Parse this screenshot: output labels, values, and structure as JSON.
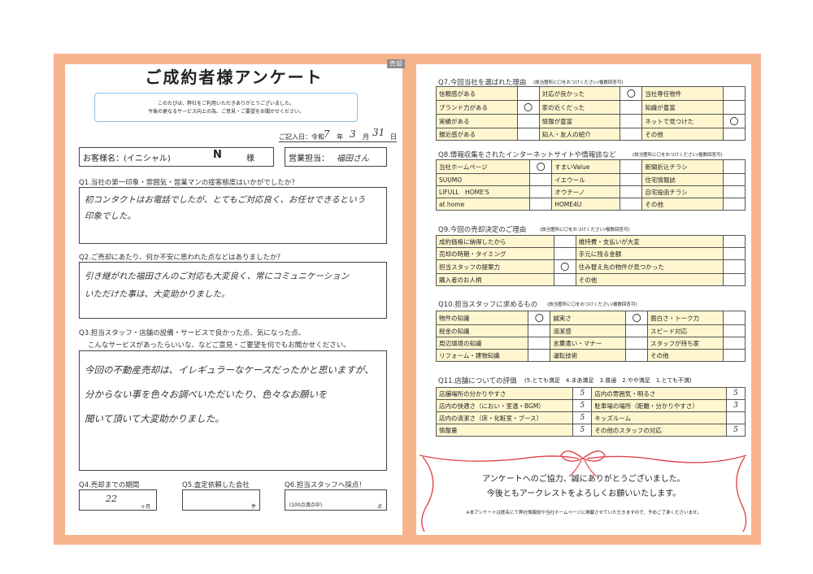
{
  "header": {
    "title": "ご成約者様アンケート",
    "tag": "売却",
    "notice_line1": "このたびは、弊社をご利用いただきありがとうございました。",
    "notice_line2": "今後の更なるサービス向上の為、ご意見・ご要望をお聞かせください。",
    "date_label": "ご記入日：令和",
    "year": "7",
    "year_unit": "年",
    "month": "3",
    "month_unit": "月",
    "day": "31",
    "day_unit": "日"
  },
  "customer": {
    "name_label": "お客様名：(イニシャル)",
    "name_value": "N",
    "honorific": "様",
    "staff_label": "営業担当：",
    "staff_value": "福田さん"
  },
  "q1": {
    "question": "Q1.当社の第一印象・雰囲気・営業マンの接客態度はいかがでしたか？",
    "answer_line1": "初コンタクトはお電話でしたが、とてもご対応良く、お任せできるという",
    "answer_line2": "印象でした。"
  },
  "q2": {
    "question": "Q2.ご売却にあたり、何か不安に思われた点などはありましたか？",
    "answer_line1": "引き継がれた福田さんのご対応も大変良く、常にコミュニケーション",
    "answer_line2": "いただけた事は、大変助かりました。"
  },
  "q3": {
    "question_line1": "Q3.担当スタッフ・店舗の設備・サービスで良かった点、気になった点、",
    "question_line2": "こんなサービスがあったらいいな、などご意見・ご要望を何でもお聞かせください。",
    "answer_line1": "今回の不動産売却は、イレギュラーなケースだったかと思いますが、",
    "answer_line2": "分からない事を色々お調べいただいたり、色々なお願いを",
    "answer_line3": "聞いて頂いて大変助かりました。"
  },
  "q4": {
    "label": "Q4.売却までの期間",
    "value": "22",
    "unit": "ヶ月"
  },
  "q5": {
    "label": "Q5.査定依頼した会社",
    "unit": "件"
  },
  "q6": {
    "label": "Q6.担当スタッフへ採点！",
    "hint": "(100点満点中)",
    "unit": "点"
  },
  "q7": {
    "title": "Q7.今回当社を選ばれた理由",
    "note": "(該当箇所に〇をおつけください/複数回答可)",
    "rows": [
      [
        {
          "l": "信頼感がある",
          "m": ""
        },
        {
          "l": "対応が良かった",
          "m": "〇"
        },
        {
          "l": "当社専任物件",
          "m": ""
        }
      ],
      [
        {
          "l": "ブランド力がある",
          "m": "〇"
        },
        {
          "l": "家の近くだった",
          "m": ""
        },
        {
          "l": "知識が豊富",
          "m": ""
        }
      ],
      [
        {
          "l": "実績がある",
          "m": ""
        },
        {
          "l": "情報が豊富",
          "m": ""
        },
        {
          "l": "ネットで見つけた",
          "m": "〇"
        }
      ],
      [
        {
          "l": "親近感がある",
          "m": ""
        },
        {
          "l": "知人・友人の紹介",
          "m": ""
        },
        {
          "l": "その他",
          "m": ""
        }
      ]
    ]
  },
  "q8": {
    "title": "Q8.情報収集をされたインターネットサイトや情報誌など",
    "note": "(該当箇所に〇をおつけください/複数回答可)",
    "rows": [
      [
        {
          "l": "当社ホームページ",
          "m": "〇"
        },
        {
          "l": "すまいValue",
          "m": ""
        },
        {
          "l": "新聞折込チラシ",
          "m": ""
        }
      ],
      [
        {
          "l": "SUUMO",
          "m": ""
        },
        {
          "l": "イエウール",
          "m": ""
        },
        {
          "l": "住宅情報誌",
          "m": ""
        }
      ],
      [
        {
          "l": "LIFULL　HOME'S",
          "m": ""
        },
        {
          "l": "オウチーノ",
          "m": ""
        },
        {
          "l": "自宅投函チラシ",
          "m": ""
        }
      ],
      [
        {
          "l": "at home",
          "m": ""
        },
        {
          "l": "HOME4U",
          "m": ""
        },
        {
          "l": "その他",
          "m": ""
        }
      ]
    ]
  },
  "q9": {
    "title": "Q9.今回の売却決定のご理由",
    "note": "(該当箇所に〇をおつけください/複数回答可)",
    "rows": [
      [
        {
          "l": "成約価格に納得したから",
          "m": ""
        },
        {
          "l": "維持費・支払いが大変",
          "m": ""
        }
      ],
      [
        {
          "l": "売却の時期・タイミング",
          "m": ""
        },
        {
          "l": "手元に残る金額",
          "m": ""
        }
      ],
      [
        {
          "l": "担当スタッフの提案力",
          "m": "〇"
        },
        {
          "l": "住み替え先の物件が見つかった",
          "m": ""
        }
      ],
      [
        {
          "l": "購入者のお人柄",
          "m": ""
        },
        {
          "l": "その他",
          "m": ""
        }
      ]
    ]
  },
  "q10": {
    "title": "Q10.担当スタッフに求めるもの",
    "note": "(該当箇所に〇をおつけください/複数回答可)",
    "rows": [
      [
        {
          "l": "物件の知識",
          "m": "〇"
        },
        {
          "l": "誠実さ",
          "m": "〇"
        },
        {
          "l": "面白さ・トーク力",
          "m": ""
        }
      ],
      [
        {
          "l": "税金の知識",
          "m": ""
        },
        {
          "l": "清潔感",
          "m": ""
        },
        {
          "l": "スピード対応",
          "m": ""
        }
      ],
      [
        {
          "l": "周辺環境の知識",
          "m": ""
        },
        {
          "l": "言葉遣い・マナー",
          "m": ""
        },
        {
          "l": "スタッフが持ち家",
          "m": ""
        }
      ],
      [
        {
          "l": "リフォーム・建物知識",
          "m": ""
        },
        {
          "l": "運転技術",
          "m": ""
        },
        {
          "l": "その他",
          "m": ""
        }
      ]
    ]
  },
  "q11": {
    "title": "Q11.店舗についての評価",
    "scale": "(5.とても満足　4.まあ満足　3.普通　2.やや満足　1.とても不満)",
    "rows": [
      [
        {
          "l": "店舗場所の分かりやすさ",
          "v": "5"
        },
        {
          "l": "店内の雰囲気・明るさ",
          "v": "5"
        }
      ],
      [
        {
          "l": "店内の快適さ（におい・室温・BGM）",
          "v": "5"
        },
        {
          "l": "駐車場の場所（距離・分かりやすさ）",
          "v": "3"
        }
      ],
      [
        {
          "l": "店内の清潔さ（床・化粧室・ブース）",
          "v": "5"
        },
        {
          "l": "キッズルーム",
          "v": ""
        }
      ],
      [
        {
          "l": "情報量",
          "v": "5"
        },
        {
          "l": "その他のスタッフの対応",
          "v": "5"
        }
      ]
    ]
  },
  "thanks": {
    "line1": "アンケートへのご協力、誠にありがとうございました。",
    "line2": "今後ともアークレストをよろしくお願いいたします。",
    "footnote": "※本アンケートは匿名にて弊社情報誌や当社ホームページに掲載させていただきますので、予めご了承くださいませ。"
  },
  "colors": {
    "frame": "#f6b48d",
    "cell": "#fff6cf",
    "ribbon": "#e0484c",
    "notice_border": "#8ec1e6"
  }
}
